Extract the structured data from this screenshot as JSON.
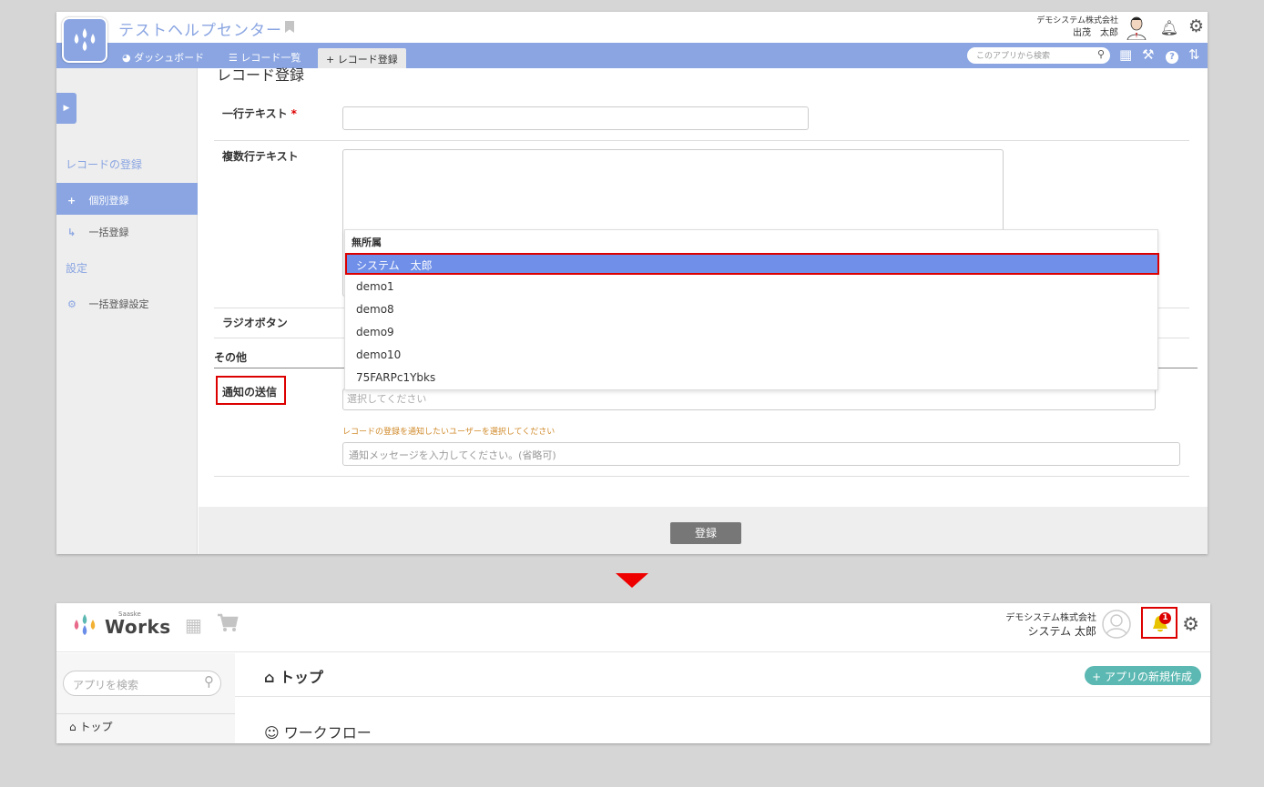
{
  "screen1": {
    "app_title": "テストヘルプセンター",
    "company": "デモシステム株式会社",
    "user": "出茂　太郎",
    "nav": {
      "dashboard": "ダッシュボード",
      "record_list": "レコード一覧",
      "record_register": "レコード登録",
      "search_placeholder": "このアプリから検索"
    },
    "sidebar": {
      "section_register": "レコードの登録",
      "item_individual": "個別登録",
      "item_bulk": "一括登録",
      "section_settings": "設定",
      "item_bulk_settings": "一括登録設定"
    },
    "form": {
      "page_title": "レコード登録",
      "label_single_line": "一行テキスト",
      "required_mark": "*",
      "label_multi_line": "複数行テキスト",
      "label_radio": "ラジオボタン",
      "label_other": "その他",
      "label_notify": "通知の送信",
      "notify_select_placeholder": "選択してください",
      "notify_hint": "レコードの登録を通知したいユーザーを選択してください",
      "notify_message_placeholder": "通知メッセージを入力してください。(省略可)",
      "submit_label": "登録"
    },
    "dropdown": {
      "group": "無所属",
      "options": [
        "システム　太郎",
        "demo1",
        "demo8",
        "demo9",
        "demo10",
        "75FARPc1Ybks"
      ],
      "selected_index": 0
    }
  },
  "screen2": {
    "logo_small": "Saaske",
    "logo_text": "Works",
    "company": "デモシステム株式会社",
    "user": "システム 太郎",
    "notification_count": "1",
    "search_placeholder": "アプリを検索",
    "sidebar_top": "トップ",
    "page_title": "トップ",
    "new_app_button": "アプリの新規作成",
    "section_workflow": "ワークフロー"
  },
  "colors": {
    "accent_blue": "#8aa5e2",
    "selected_blue": "#6f8fe8",
    "highlight_red": "#dd0000",
    "teal_button": "#5cb8b2",
    "bell_yellow": "#e8c400"
  }
}
